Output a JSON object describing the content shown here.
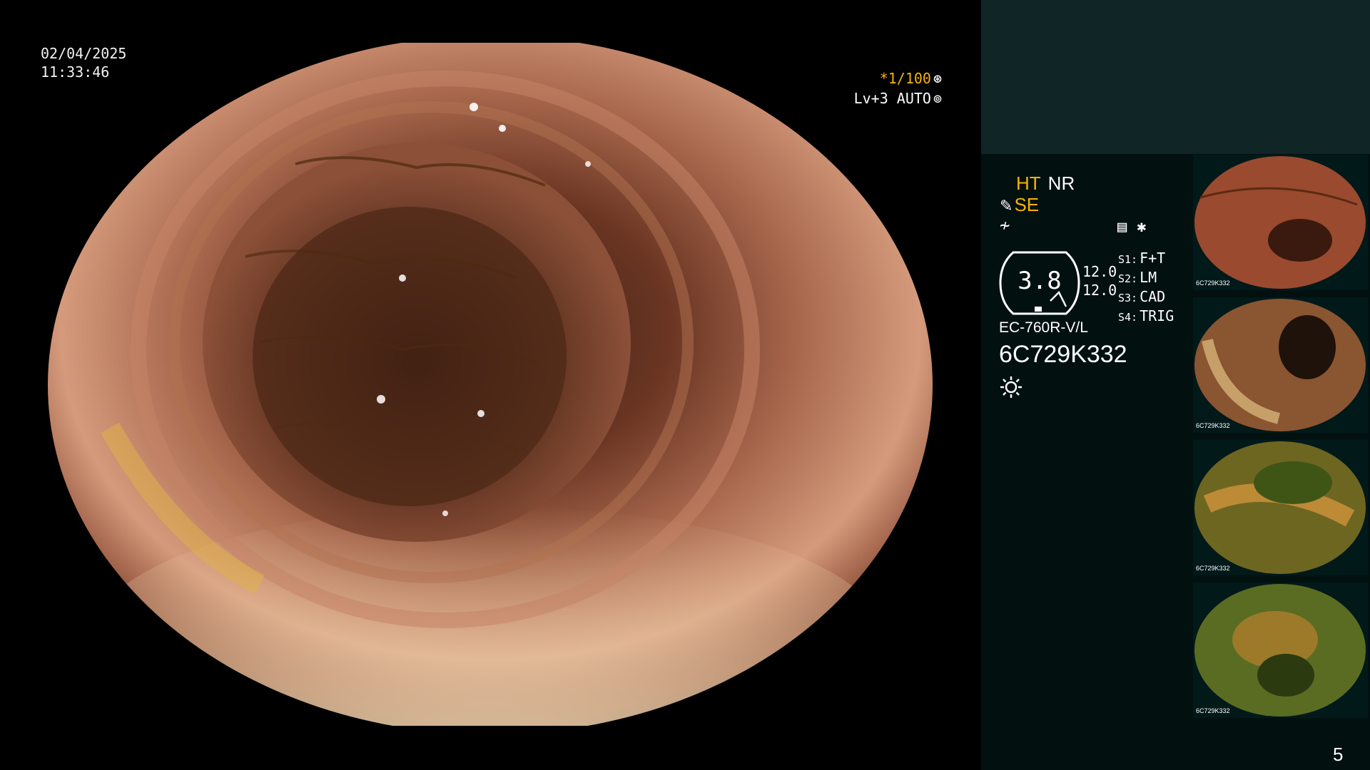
{
  "datetime": {
    "date": "02/04/2025",
    "time": "11:33:46"
  },
  "status": {
    "shutter": "*1/100",
    "shutter_icon": "aperture-icon",
    "level": "Lv+3 AUTO",
    "level_icon": "auto-iris-icon"
  },
  "panel": {
    "ht": "HT",
    "nr": "NR",
    "se": "SE",
    "pen_icon": "pen-icon",
    "flash_icon": "flash-icon",
    "gauge_value": "3.8",
    "values": [
      "12.0",
      "12.0"
    ],
    "switches": [
      {
        "label": "S1:",
        "value": "F+T"
      },
      {
        "label": "S2:",
        "value": "LM"
      },
      {
        "label": "S3:",
        "value": "CAD"
      },
      {
        "label": "S4:",
        "value": "TRIG"
      }
    ],
    "scope_model": "EC-760R-V/L",
    "scope_serial": "6C729K332",
    "light_icon": "sun-icon"
  },
  "thumbnails": [
    {
      "label": "6C729K332",
      "tint": "#9a4a2e"
    },
    {
      "label": "6C729K332",
      "tint": "#8a5531"
    },
    {
      "label": "6C729K332",
      "tint": "#6d6621"
    },
    {
      "label": "6C729K332",
      "tint": "#5a6c22"
    }
  ],
  "page_number": "5",
  "colors": {
    "accent_yellow": "#f5b400",
    "panel_dark": "#031010",
    "panel_top": "#0f2526"
  }
}
